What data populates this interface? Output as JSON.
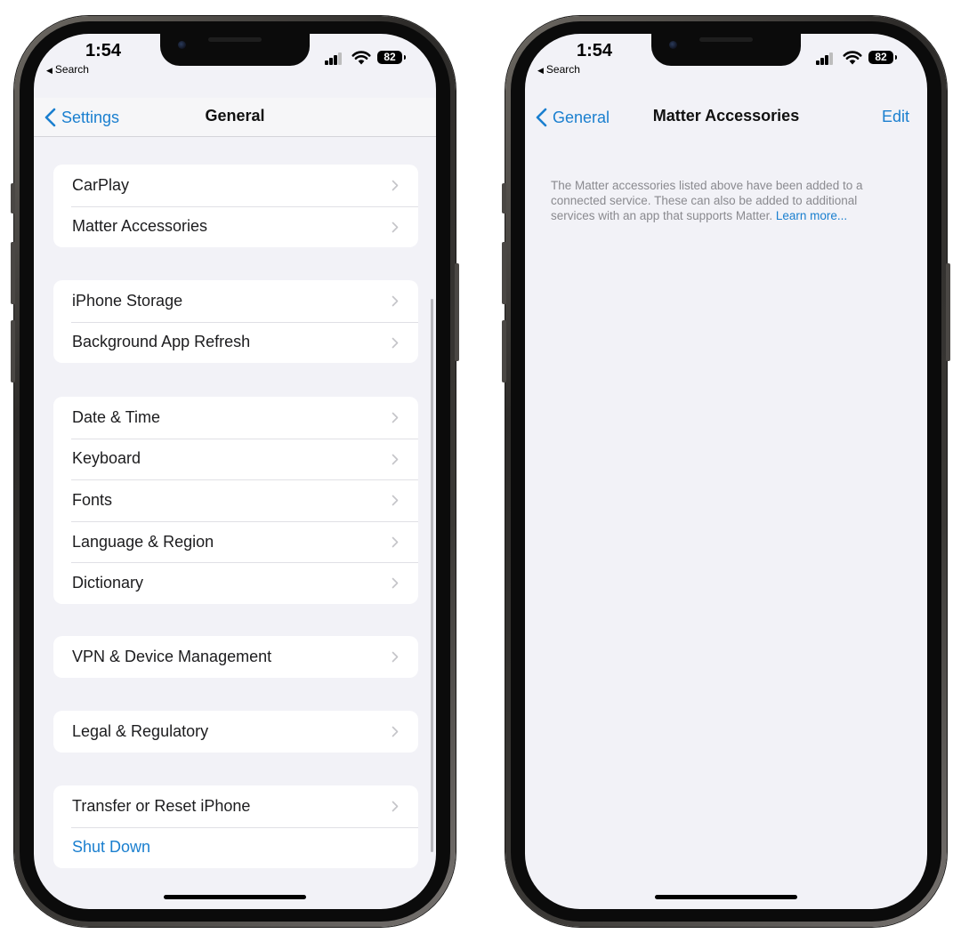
{
  "left_phone": {
    "status": {
      "time": "1:54",
      "back_app": "Search",
      "battery": "82"
    },
    "nav": {
      "back": "Settings",
      "title": "General"
    },
    "groups": [
      {
        "items": [
          {
            "label": "CarPlay"
          },
          {
            "label": "Matter Accessories"
          }
        ]
      },
      {
        "items": [
          {
            "label": "iPhone Storage"
          },
          {
            "label": "Background App Refresh"
          }
        ]
      },
      {
        "items": [
          {
            "label": "Date & Time"
          },
          {
            "label": "Keyboard"
          },
          {
            "label": "Fonts"
          },
          {
            "label": "Language & Region"
          },
          {
            "label": "Dictionary"
          }
        ]
      },
      {
        "items": [
          {
            "label": "VPN & Device Management"
          }
        ]
      },
      {
        "items": [
          {
            "label": "Legal & Regulatory"
          }
        ]
      },
      {
        "items": [
          {
            "label": "Transfer or Reset iPhone"
          },
          {
            "label": "Shut Down"
          }
        ]
      }
    ]
  },
  "right_phone": {
    "status": {
      "time": "1:54",
      "back_app": "Search",
      "battery": "82"
    },
    "nav": {
      "back": "General",
      "title": "Matter Accessories",
      "edit": "Edit"
    },
    "footer": {
      "text": "The Matter accessories listed above have been added to a connected service. These can also be added to additional services with an app that supports Matter.",
      "link": "Learn more..."
    }
  },
  "colors": {
    "accent": "#1a7fcf",
    "background": "#f2f2f7",
    "label": "#1c1c1e",
    "secondary": "#8a8a8f"
  },
  "icons": [
    "chevron-left-icon",
    "chevron-right-icon",
    "cellular-signal-icon",
    "wifi-icon",
    "battery-icon"
  ]
}
